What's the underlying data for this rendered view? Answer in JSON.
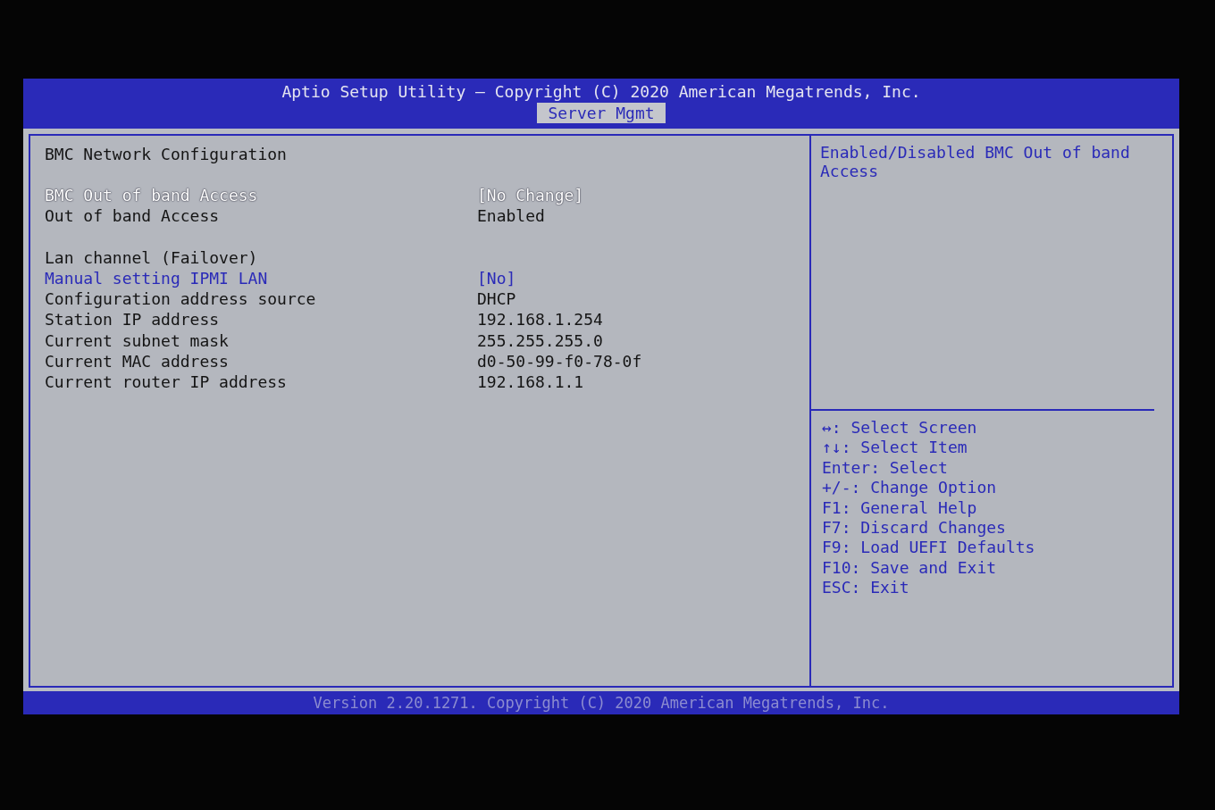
{
  "header": {
    "title": "Aptio Setup Utility – Copyright (C) 2020 American Megatrends, Inc.",
    "tabs": [
      {
        "label": "Server Mgmt",
        "selected": true
      }
    ]
  },
  "main": {
    "heading": "BMC Network Configuration",
    "groups": [
      [
        {
          "label": "BMC Out of band Access",
          "value": "[No Change]",
          "kind": "option",
          "selected": true
        },
        {
          "label": "Out of band Access",
          "value": "Enabled",
          "kind": "info",
          "selected": false
        }
      ],
      [
        {
          "label": "Lan channel (Failover)",
          "kind": "info",
          "selected": false
        },
        {
          "label": "Manual setting IPMI LAN",
          "value": "[No]",
          "kind": "option",
          "selected": false
        },
        {
          "label": "Configuration address source",
          "value": "DHCP",
          "kind": "info",
          "selected": false
        },
        {
          "label": "Station IP address",
          "value": "192.168.1.254",
          "kind": "info",
          "selected": false
        },
        {
          "label": "Current subnet mask",
          "value": "255.255.255.0",
          "kind": "info",
          "selected": false
        },
        {
          "label": "Current MAC address",
          "value": "d0-50-99-f0-78-0f",
          "kind": "info",
          "selected": false
        },
        {
          "label": "Current router IP address",
          "value": "192.168.1.1",
          "kind": "info",
          "selected": false
        }
      ]
    ]
  },
  "help": {
    "text": "Enabled/Disabled BMC Out of band Access",
    "keys": [
      "↔: Select Screen",
      "↑↓: Select Item",
      "Enter: Select",
      "+/-: Change Option",
      "F1: General Help",
      "F7: Discard Changes",
      "F9: Load UEFI Defaults",
      "F10: Save and Exit",
      "ESC: Exit"
    ]
  },
  "footer": {
    "text": "Version 2.20.1271. Copyright (C) 2020 American Megatrends, Inc."
  }
}
